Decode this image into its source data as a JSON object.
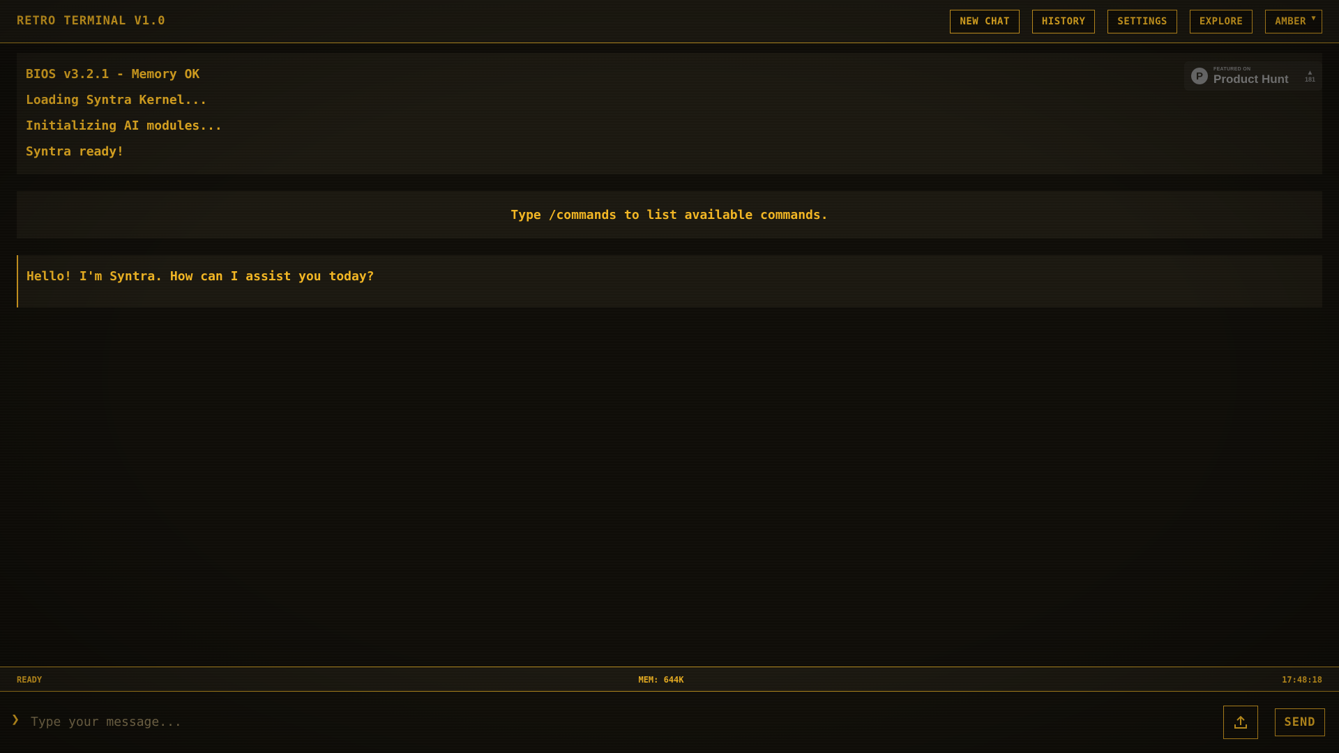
{
  "header": {
    "title": "RETRO TERMINAL V1.0",
    "nav": {
      "new_chat": "NEW CHAT",
      "history": "HISTORY",
      "settings": "SETTINGS",
      "explore": "EXPLORE",
      "theme": "AMBER",
      "theme_caret": "▼"
    }
  },
  "boot": {
    "lines": [
      "BIOS v3.2.1 - Memory OK",
      "Loading Syntra Kernel...",
      "Initializing AI modules...",
      "Syntra ready!"
    ]
  },
  "product_hunt": {
    "logo_letter": "P",
    "featured_label": "FEATURED ON",
    "name": "Product Hunt",
    "vote_arrow": "▲",
    "votes": "181"
  },
  "hint": {
    "text": "Type /commands to list available commands."
  },
  "messages": [
    {
      "text": "Hello! I'm Syntra. How can I assist you today?"
    }
  ],
  "status": {
    "state": "READY",
    "memory": "MEM: 644K",
    "time": "17:48:18"
  },
  "input": {
    "prompt": "❯",
    "value": "",
    "placeholder": "Type your message...",
    "upload_icon": "upload-icon",
    "send_label": "SEND"
  },
  "colors": {
    "accent": "#f2b623",
    "background": "#0f0d08",
    "panel": "#1b1810",
    "border": "#d9a021"
  }
}
